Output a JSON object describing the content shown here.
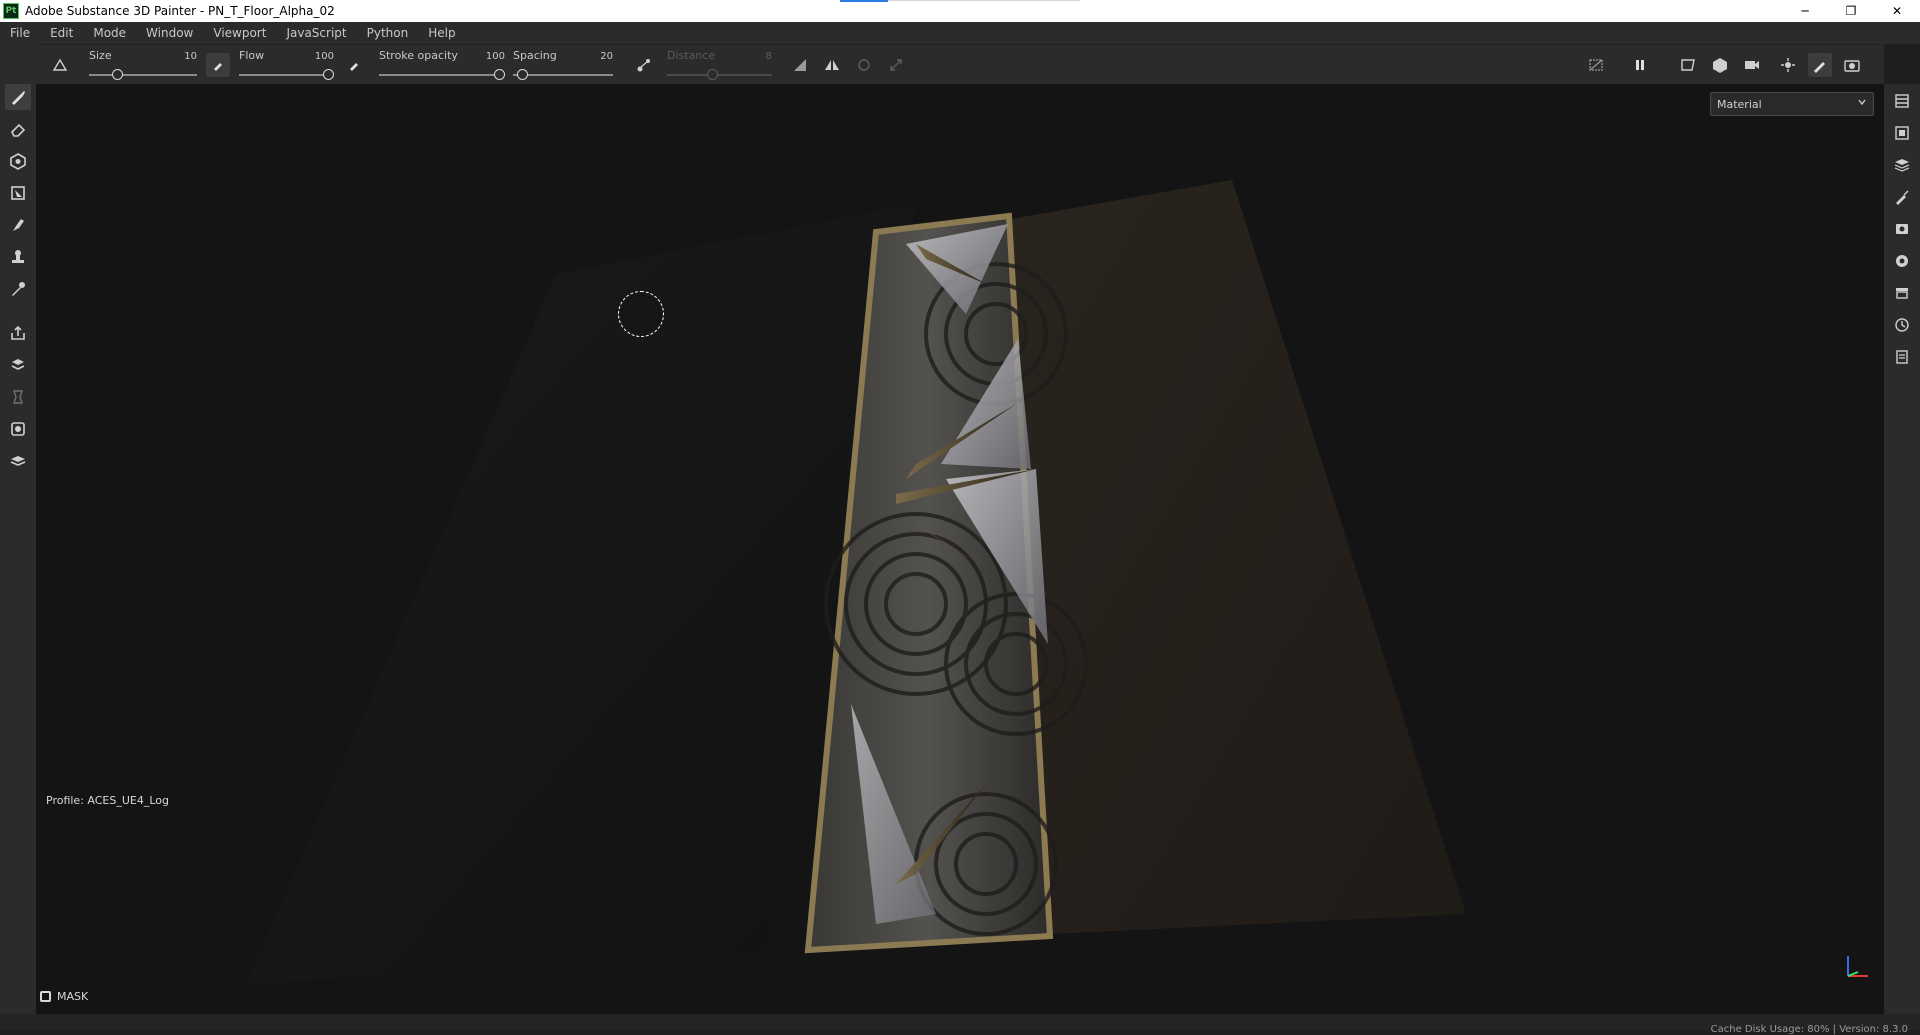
{
  "window": {
    "app_icon_text": "Pt",
    "title": "Adobe Substance 3D Painter - PN_T_Floor_Alpha_02",
    "minimize": "─",
    "restore": "❐",
    "close": "✕"
  },
  "menu": [
    "File",
    "Edit",
    "Mode",
    "Window",
    "Viewport",
    "JavaScript",
    "Python",
    "Help"
  ],
  "toolbar": {
    "size": {
      "label": "Size",
      "value": "10",
      "level": 0.1
    },
    "flow": {
      "label": "Flow",
      "value": "100",
      "level": 1.0
    },
    "stroke_opacity": {
      "label": "Stroke opacity",
      "value": "100",
      "level": 1.0
    },
    "spacing": {
      "label": "Spacing",
      "value": "20",
      "level": 0.05
    },
    "distance": {
      "label": "Distance",
      "value": "8",
      "level": 0.5,
      "disabled": true
    }
  },
  "left_tools": [
    "paint-brush-icon",
    "eraser-icon",
    "projection-icon",
    "polygon-fill-icon",
    "smudge-icon",
    "clone-icon",
    "color-picker-icon",
    "export-icon",
    "bake-icon",
    "geometry-mask-icon",
    "texture-set-icon",
    "shelf-icon"
  ],
  "right_tools": [
    "layers-panel-icon",
    "texture-set-list-icon",
    "layer-stack-icon",
    "properties-icon",
    "display-settings-icon",
    "environment-icon",
    "shelf-panel-icon",
    "history-icon",
    "log-icon"
  ],
  "viewport": {
    "material_mode": "Material",
    "profile": "Profile: ACES_UE4_Log",
    "mask": "MASK"
  },
  "status": {
    "text": "Cache Disk Usage:  80%  |  Version: 8.3.0"
  },
  "colors": {
    "panel": "#2b2b2b",
    "viewport": "#141414",
    "accent": "#2a7ce0"
  }
}
